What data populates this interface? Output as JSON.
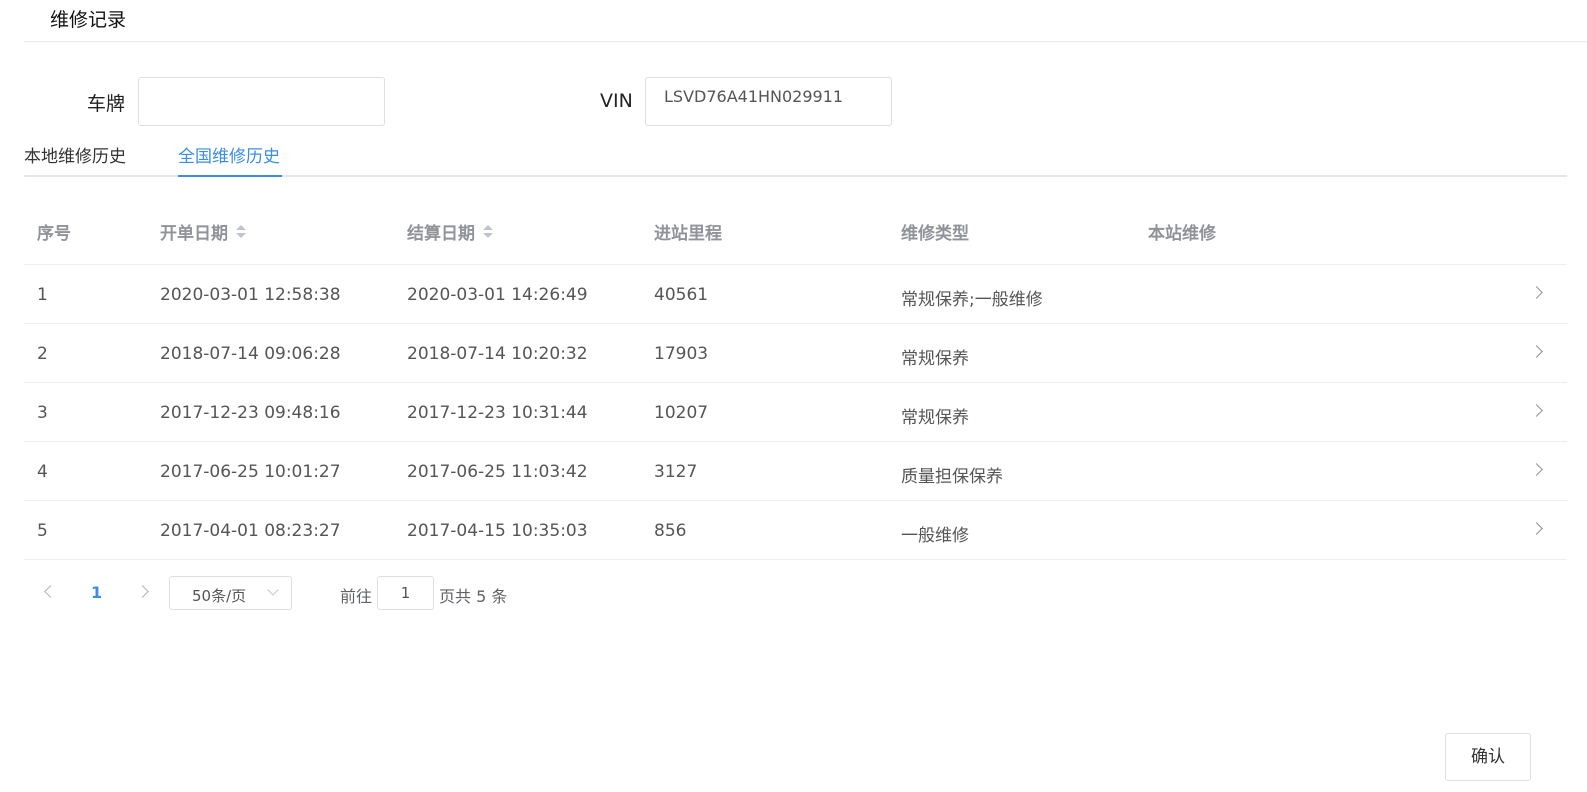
{
  "header": {
    "title": "维修记录"
  },
  "form": {
    "plate_label": "车牌",
    "plate_value": "",
    "vin_label": "VIN",
    "vin_value": "LSVD76A41HN029911"
  },
  "tabs": [
    {
      "label": "本地维修历史",
      "active": false
    },
    {
      "label": "全国维修历史",
      "active": true
    }
  ],
  "table": {
    "columns": [
      "序号",
      "开单日期",
      "结算日期",
      "进站里程",
      "维修类型",
      "本站维修"
    ],
    "rows": [
      [
        "1",
        "2020-03-01 12:58:38",
        "2020-03-01 14:26:49",
        "40561",
        "常规保养;一般维修",
        ""
      ],
      [
        "2",
        "2018-07-14 09:06:28",
        "2018-07-14 10:20:32",
        "17903",
        "常规保养",
        ""
      ],
      [
        "3",
        "2017-12-23 09:48:16",
        "2017-12-23 10:31:44",
        "10207",
        "常规保养",
        ""
      ],
      [
        "4",
        "2017-06-25 10:01:27",
        "2017-06-25 11:03:42",
        "3127",
        "质量担保保养",
        ""
      ],
      [
        "5",
        "2017-04-01 08:23:27",
        "2017-04-15 10:35:03",
        "856",
        "一般维修",
        ""
      ]
    ]
  },
  "pagination": {
    "current_page": "1",
    "page_size": "50条/页",
    "goto_label": "前往",
    "goto_value": "1",
    "total_text": "页共 5 条"
  },
  "footer": {
    "confirm_label": "确认"
  },
  "colors": {
    "accent": "#3a8ee6",
    "border": "#dcdfe6",
    "header_text": "#909399"
  }
}
